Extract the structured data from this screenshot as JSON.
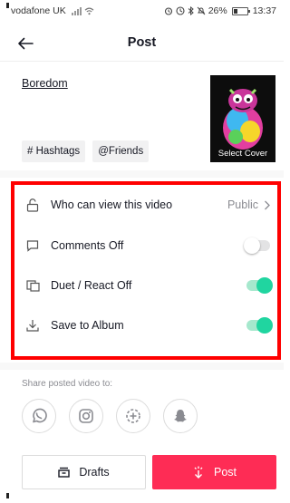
{
  "status_bar": {
    "carrier": "vodafone UK",
    "battery_text": "26%",
    "time": "13:37"
  },
  "header": {
    "title": "Post"
  },
  "caption": "Boredom",
  "cover": {
    "label": "Select Cover"
  },
  "tags": {
    "hashtags": "# Hashtags",
    "friends": "@Friends"
  },
  "settings": {
    "who_can_view": {
      "label": "Who can view this video",
      "value": "Public"
    },
    "comments": {
      "label": "Comments Off",
      "enabled": false
    },
    "duet": {
      "label": "Duet / React Off",
      "enabled": true
    },
    "save": {
      "label": "Save to Album",
      "enabled": true
    }
  },
  "share": {
    "label": "Share posted video to:",
    "targets": [
      "whatsapp-icon",
      "instagram-icon",
      "stories-icon",
      "snapchat-icon"
    ]
  },
  "actions": {
    "drafts": "Drafts",
    "post": "Post"
  },
  "colors": {
    "accent_post": "#fe2c55",
    "toggle_on": "#20d5a0",
    "highlight_border": "#ff0000"
  }
}
